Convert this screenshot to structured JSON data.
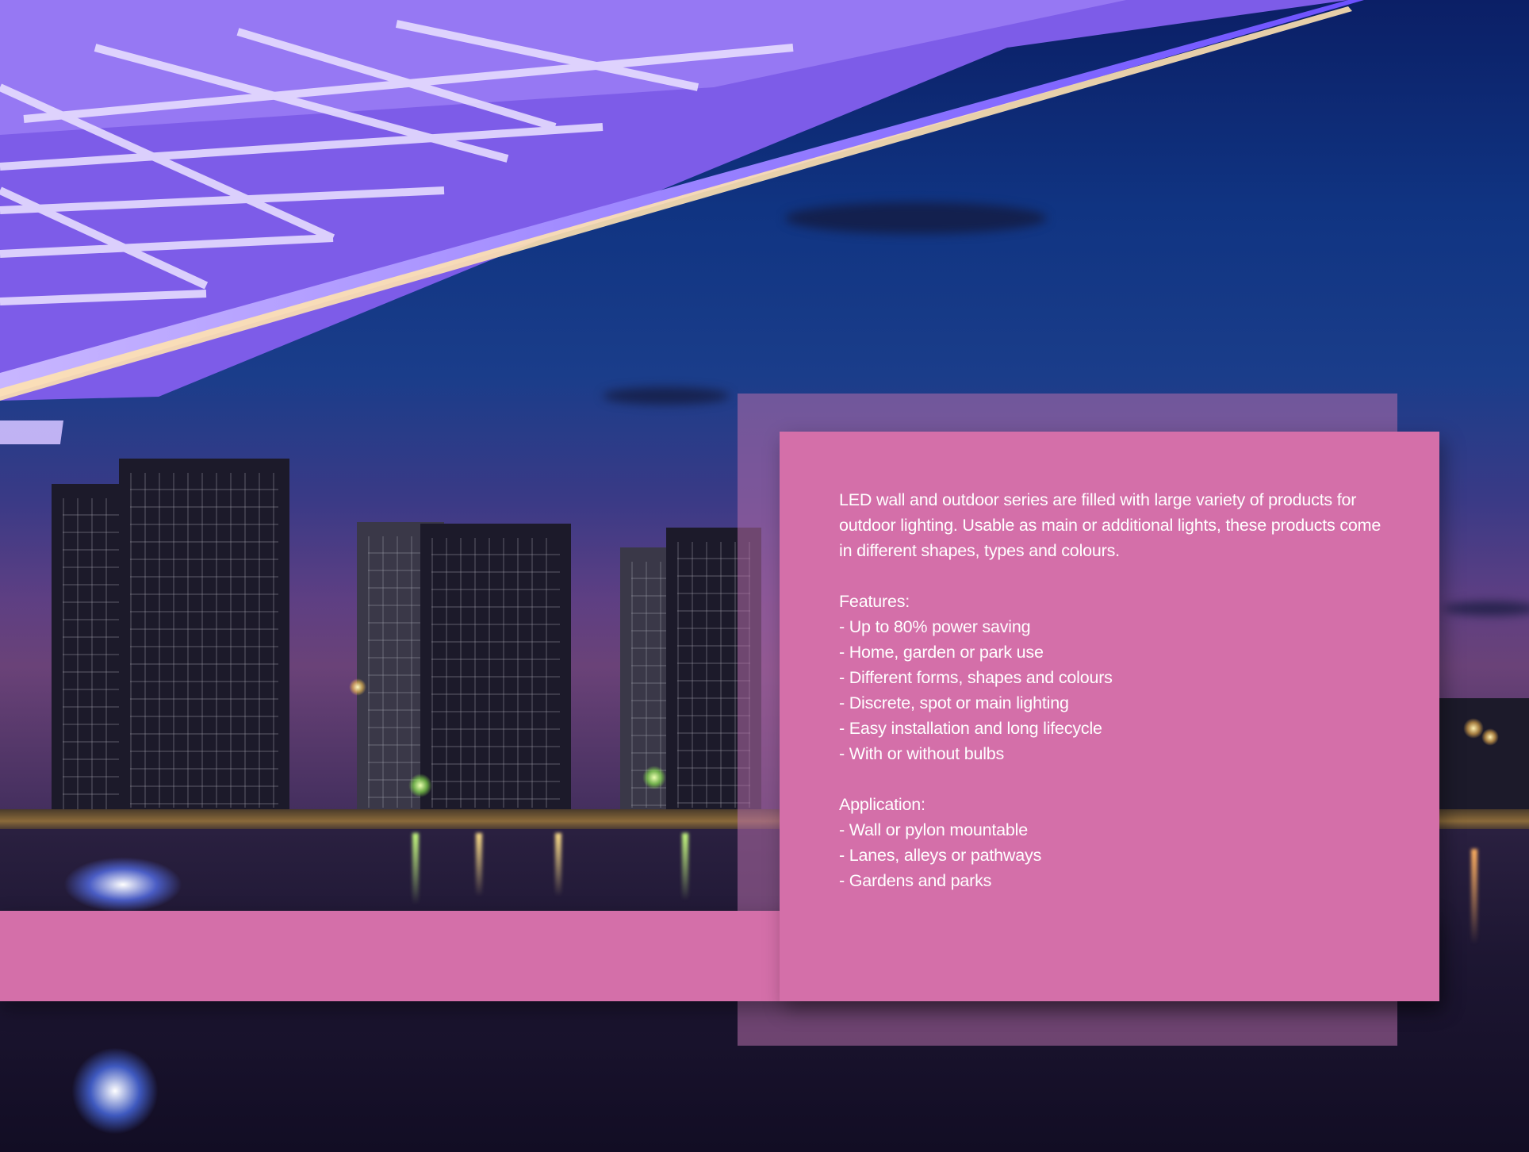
{
  "scene": {
    "colors": {
      "sky_top": "#0b1f66",
      "sky_horizon": "#6a4278",
      "bridge_light": "#8f6cff",
      "panel_pink": "#d46fa9",
      "text": "#ffffff"
    }
  },
  "info_panel": {
    "intro": "LED wall and outdoor series are filled with large variety of products for outdoor lighting. Usable as main or additional lights, these products come in different shapes, types and colours.",
    "features_heading": "Features:",
    "features": [
      "- Up to 80% power saving",
      "- Home, garden or park use",
      "- Different forms, shapes and colours",
      "- Discrete, spot or main lighting",
      "- Easy installation and long lifecycle",
      "- With or without bulbs"
    ],
    "application_heading": "Application:",
    "applications": [
      "- Wall or pylon mountable",
      "- Lanes, alleys or pathways",
      "- Gardens and parks"
    ]
  }
}
